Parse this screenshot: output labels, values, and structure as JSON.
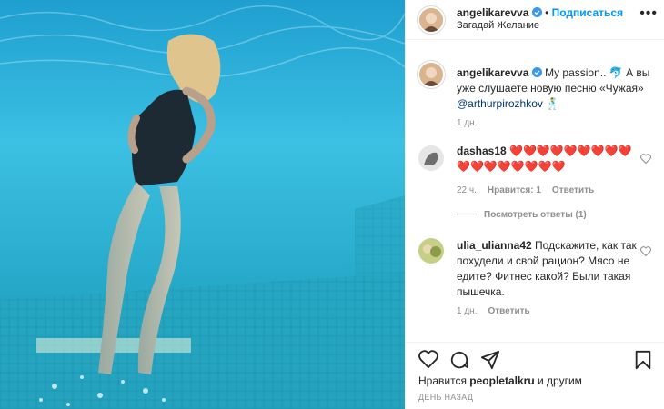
{
  "header": {
    "username": "angelikarevva",
    "follow_label": "Подписаться",
    "subtitle": "Загадай Желание",
    "more_label": "•••"
  },
  "caption": {
    "username": "angelikarevva",
    "text_part1": "My passion.. ",
    "text_part2": " А вы уже слушаете новую песню «Чужая» ",
    "mention": "@arthurpirozhkov",
    "time": "1 дн."
  },
  "comments": [
    {
      "username": "dashas18",
      "hearts": "❤️❤️❤️❤️❤️❤️❤️❤️❤️❤️❤️❤️❤️❤️❤️❤️❤️",
      "time": "22 ч.",
      "likes_label": "Нравится: 1",
      "reply_label": "Ответить",
      "view_replies": "Посмотреть ответы (1)"
    },
    {
      "username": "ulia_ulianna42",
      "text": "Подскажите, как так похудели и свой рацион? Мясо не едите? Фитнес какой? Были такая пышечка.",
      "time": "1 дн.",
      "reply_label": "Ответить"
    }
  ],
  "likes": {
    "prefix": "Нравится",
    "user": "peopletalkru",
    "suffix": "и другим"
  },
  "date_label": "ДЕНЬ НАЗАД",
  "icons": [
    "verified-badge-icon",
    "more-icon",
    "heart-icon",
    "comment-icon",
    "share-icon",
    "bookmark-icon"
  ],
  "colors": {
    "accent": "#0095f6",
    "text": "#262626",
    "muted": "#8e8e8e",
    "water": "#2aa8d0"
  }
}
